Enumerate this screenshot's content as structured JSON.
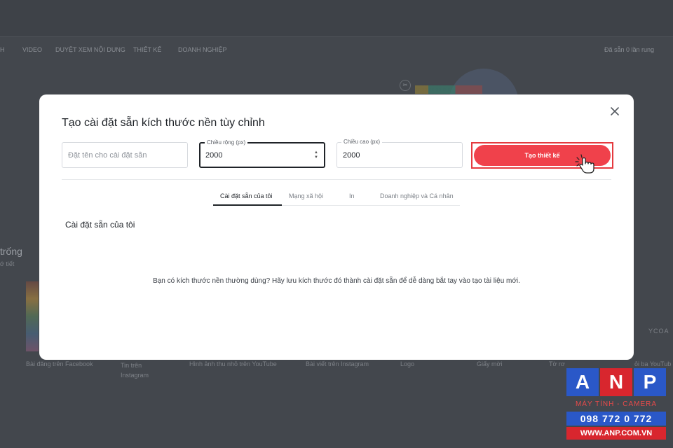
{
  "background": {
    "nav": [
      "H",
      "VIDEO",
      "DUYỆT XEM NỘI DUNG",
      "THIẾT KẾ",
      "DOANH NGHIỆP"
    ],
    "nav_right": "Đã sẵn 0 lần rung",
    "heading": "trống",
    "subheading": "ớ tiết",
    "bottom_labels": [
      "Bài đăng trên Facebook",
      "Tin trên Instagram",
      "Hình ảnh thu nhỏ trên YouTube",
      "Bài viết trên Instagram",
      "Logo",
      "Giấy mời",
      "Tờ rơ",
      "ỏi ba YouTub"
    ],
    "corner_text": "YCOA"
  },
  "modal": {
    "title": "Tạo cài đặt sẵn kích thước nền tùy chỉnh",
    "name_field": {
      "placeholder": "Đặt tên cho cài đặt sẵn",
      "value": ""
    },
    "width_field": {
      "label": "Chiều rộng (px)",
      "value": "2000"
    },
    "height_field": {
      "label": "Chiều cao (px)",
      "value": "2000"
    },
    "create_button": "Tạo thiết kế",
    "tabs": [
      {
        "label": "Cài đặt sẵn của tôi",
        "active": true
      },
      {
        "label": "Mạng xã hội",
        "active": false
      },
      {
        "label": "In",
        "active": false
      },
      {
        "label": "Doanh nghiệp và Cá nhân",
        "active": false
      }
    ],
    "section_title": "Cài đặt sẵn của tôi",
    "empty_message": "Bạn có kích thước nền thường dùng? Hãy lưu kích thước đó thành cài đặt sẵn để dễ dàng bắt tay vào tạo tài liệu mới."
  },
  "watermark": {
    "letters": [
      "A",
      "N",
      "P"
    ],
    "letter_colors": [
      "#2a58c8",
      "#d8262e",
      "#2a58c8"
    ],
    "tagline": "MÁY TÍNH - CAMERA",
    "phone": "098 772 0 772",
    "website": "WWW.ANP.COM.VN"
  },
  "colors": {
    "accent": "#f0414b",
    "overlay": "#43474d"
  }
}
